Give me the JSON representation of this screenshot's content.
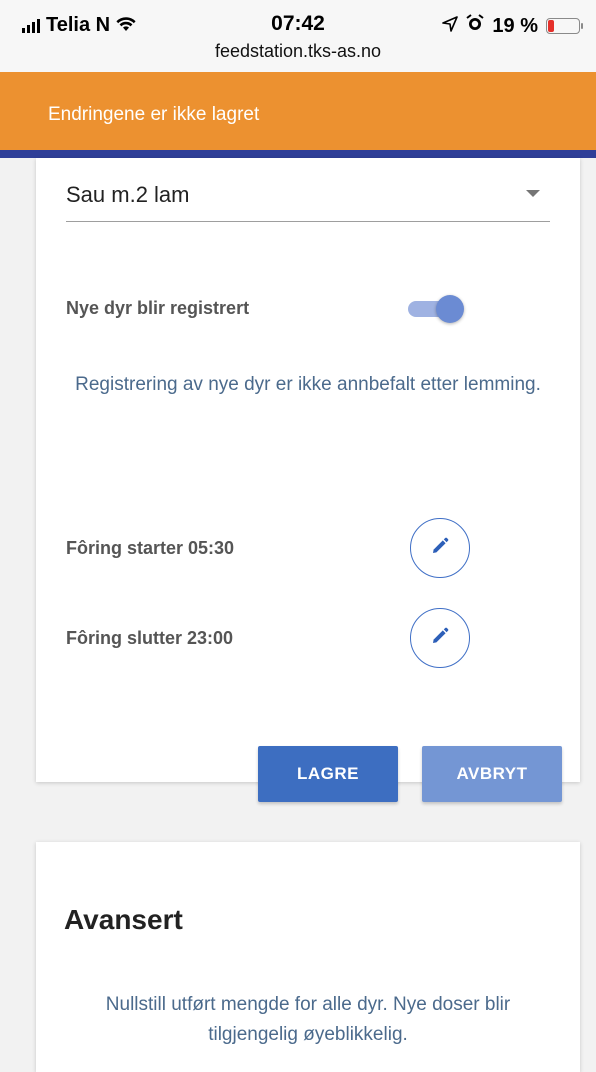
{
  "status_bar": {
    "carrier": "Telia N",
    "time": "07:42",
    "url": "feedstation.tks-as.no",
    "battery_percent": "19 %",
    "battery_level": 0.19,
    "battery_color": "#e5302a"
  },
  "banner": {
    "text": "Endringene er ikke lagret",
    "color": "#ec9130"
  },
  "settings_card": {
    "selected_group": "Sau m.2 lam",
    "register_new_label": "Nye dyr blir registrert",
    "register_new_enabled": true,
    "notice": "Registrering av nye dyr er ikke annbefalt etter lemming.",
    "feeding_start": "Fôring starter 05:30",
    "feeding_end": "Fôring slutter 23:00",
    "save_label": "LAGRE",
    "cancel_label": "AVBRYT",
    "accent_color": "#3d6ec1"
  },
  "advanced_card": {
    "title": "Avansert",
    "text": "Nullstill utført mengde for alle dyr. Nye doser blir tilgjengelig øyeblikkelig."
  },
  "icons": {
    "signal": "cellular-signal-icon",
    "wifi": "wifi-icon",
    "location": "location-arrow-icon",
    "alarm": "alarm-icon",
    "battery": "battery-icon",
    "dropdown": "chevron-down-icon",
    "edit": "pencil-icon"
  }
}
